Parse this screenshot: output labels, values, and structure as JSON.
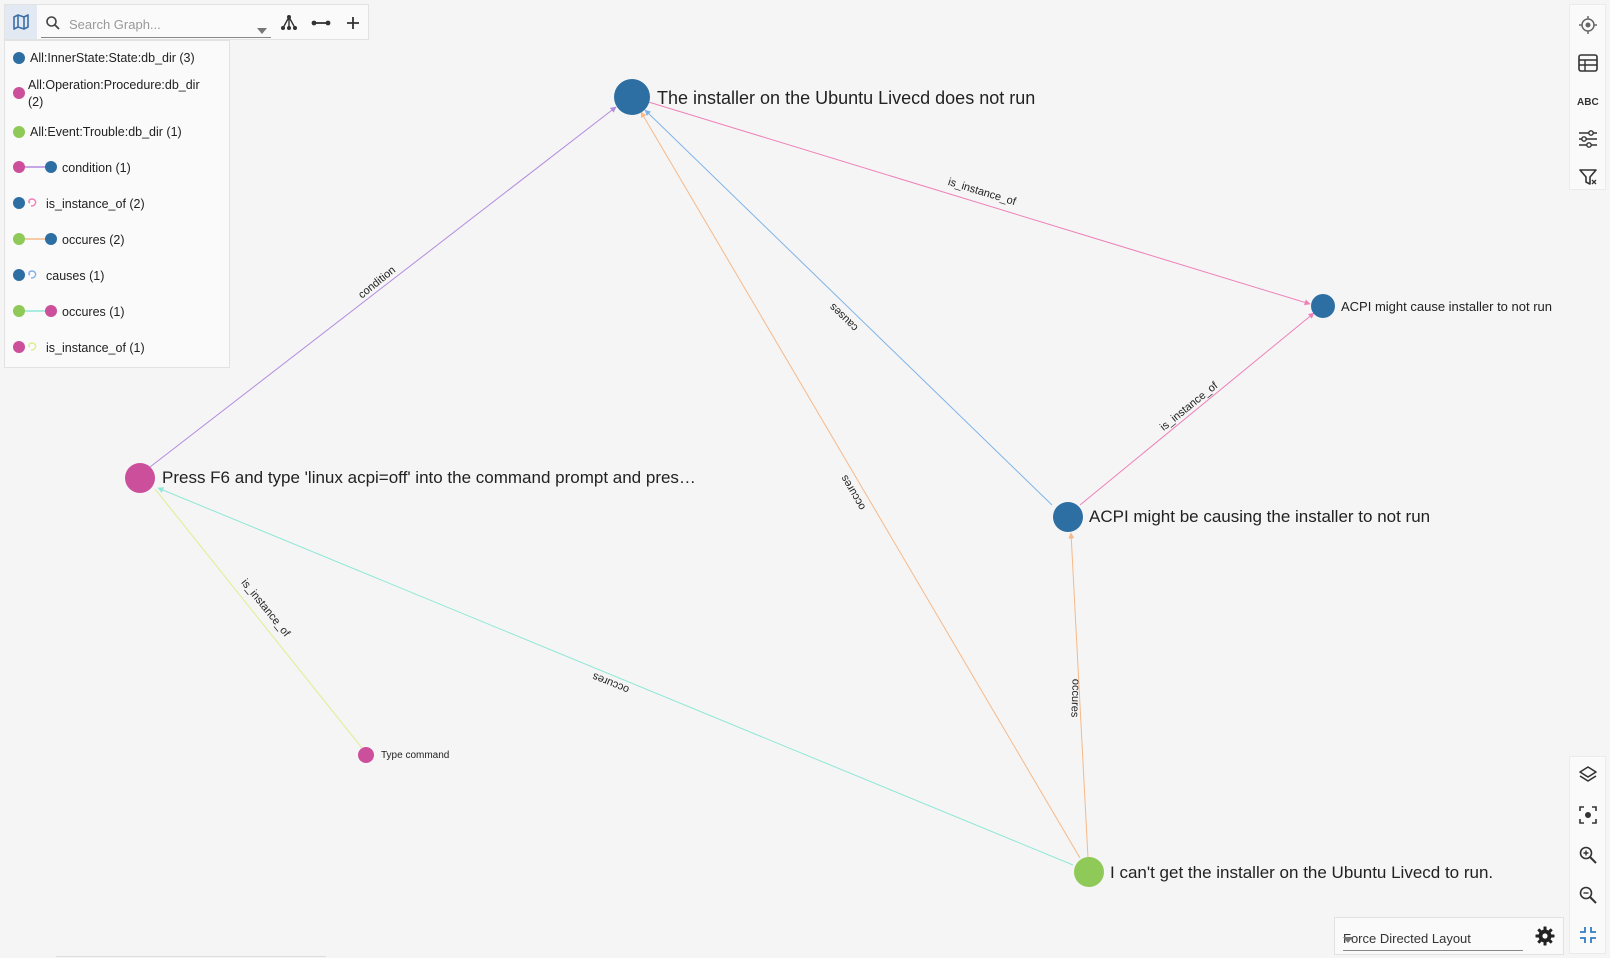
{
  "toolbar": {
    "search_placeholder": "Search Graph...",
    "icons": [
      "map-icon",
      "search-icon",
      "hierarchy-icon",
      "edge-icon",
      "plus-icon"
    ]
  },
  "legend": {
    "items": [
      {
        "label": "All:InnerState:State:db_dir (3)",
        "kind": "node",
        "color": "#2e6fa3"
      },
      {
        "label": "All:Operation:Procedure:db_dir",
        "label2": "(2)",
        "kind": "node",
        "color": "#cc4f9b"
      },
      {
        "label": "All:Event:Trouble:db_dir (1)",
        "kind": "node",
        "color": "#8fc957"
      },
      {
        "label": "condition (1)",
        "kind": "edge",
        "from": "#cc4f9b",
        "to": "#2e6fa3",
        "edge_color": "#b58be0"
      },
      {
        "label": "is_instance_of (2)",
        "kind": "self",
        "from": "#2e6fa3",
        "edge_color": "#ef7fb8"
      },
      {
        "label": "occures (2)",
        "kind": "edge",
        "from": "#8fc957",
        "to": "#2e6fa3",
        "edge_color": "#f5b98a"
      },
      {
        "label": "causes (1)",
        "kind": "self",
        "from": "#2e6fa3",
        "edge_color": "#7fb3e8"
      },
      {
        "label": "occures (1)",
        "kind": "edge",
        "from": "#8fc957",
        "to": "#cc4f9b",
        "edge_color": "#8fe8d6"
      },
      {
        "label": "is_instance_of (1)",
        "kind": "self",
        "from": "#cc4f9b",
        "edge_color": "#d9f08a"
      }
    ]
  },
  "graph": {
    "nodes": {
      "n1": {
        "label": "The installer on the Ubuntu Livecd does not run",
        "color": "#2e6fa3"
      },
      "n2": {
        "label": "ACPI might cause installer to not run",
        "color": "#2e6fa3"
      },
      "n3": {
        "label": "Press F6 and type 'linux acpi=off' into the command prompt and pres…",
        "color": "#cc4f9b"
      },
      "n4": {
        "label": "ACPI might be causing the installer to not run",
        "color": "#2e6fa3"
      },
      "n5": {
        "label": "Type command",
        "color": "#cc4f9b"
      },
      "n6": {
        "label": "I can't get the installer on the Ubuntu Livecd to run.",
        "color": "#8fc957"
      }
    },
    "edges": {
      "e_condition": "condition",
      "e_instance_top": "is_instance_of",
      "e_causes": "causes",
      "e_occures_mid": "occures",
      "e_instance_right": "is_instance_of",
      "e_instance_left": "is_instance_of",
      "e_occures_long": "occures",
      "e_occures_right": "occures"
    }
  },
  "side_tools": {
    "top": [
      "locate-icon",
      "table-icon",
      "abc-icon",
      "sliders-icon",
      "filter-icon"
    ],
    "bottom": [
      "layers-icon",
      "focus-icon",
      "zoom-in-icon",
      "zoom-out-icon",
      "collapse-icon"
    ]
  },
  "layout": {
    "selected": "Force Directed Layout"
  }
}
